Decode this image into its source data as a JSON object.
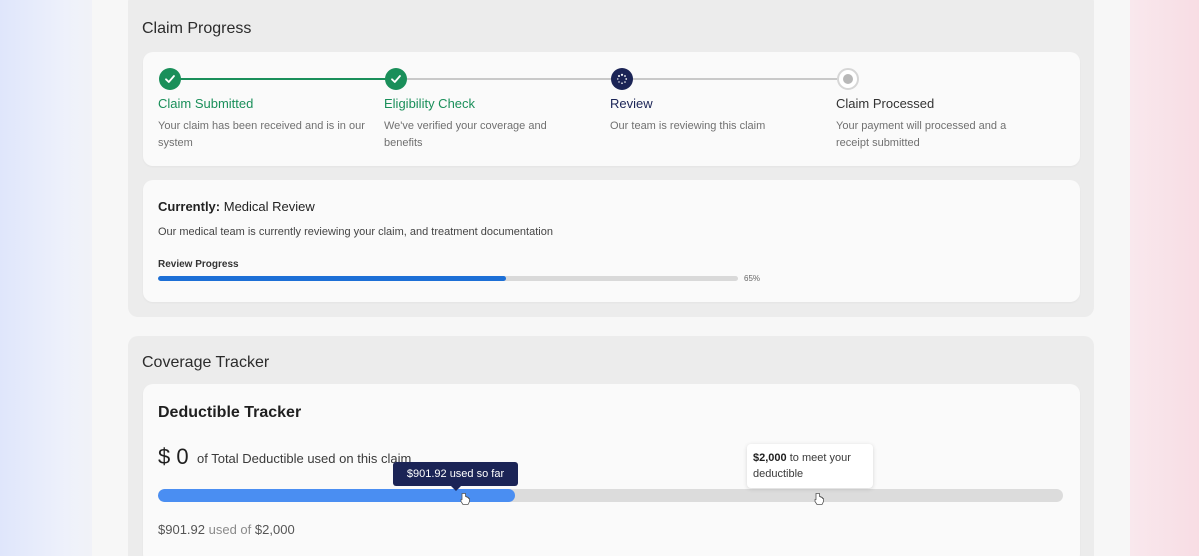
{
  "claim_progress": {
    "title": "Claim Progress",
    "steps": [
      {
        "title": "Claim Submitted",
        "description": "Your claim has been received and is in our system",
        "status": "done",
        "icon": "check-icon"
      },
      {
        "title": "Eligibility Check",
        "description": "We've verified your coverage and benefits",
        "status": "done",
        "icon": "check-icon"
      },
      {
        "title": "Review",
        "description": "Our team is reviewing this claim",
        "status": "active",
        "icon": "spinner-icon"
      },
      {
        "title": "Claim Processed",
        "description": "Your payment will processed and a receipt submitted",
        "status": "pending",
        "icon": "pending-dot-icon"
      }
    ],
    "current": {
      "label": "Currently:",
      "value": "Medical Review",
      "description": "Our medical team is currently reviewing your claim, and treatment documentation",
      "progress_label": "Review Progress",
      "progress_text": "65%",
      "progress_fraction": 0.6
    }
  },
  "coverage_tracker": {
    "title": "Coverage Tracker",
    "deductible": {
      "title": "Deductible Tracker",
      "big_amount": "$ 0",
      "caption": "of Total Deductible used on this claim",
      "tooltip_used": "$901.92 used so far",
      "tooltip_remaining_amount": "$2,000",
      "tooltip_remaining_text": "to meet your deductible",
      "bar_fill_fraction": 0.395,
      "summary_used": "$901.92",
      "summary_of": "used of",
      "summary_total": "$2,000"
    }
  },
  "colors": {
    "done": "#1a8f5a",
    "active": "#1b2456",
    "progress_blue": "#1c6fd6",
    "deductible_blue": "#4a8ef2",
    "track": "#dcdcdc"
  }
}
